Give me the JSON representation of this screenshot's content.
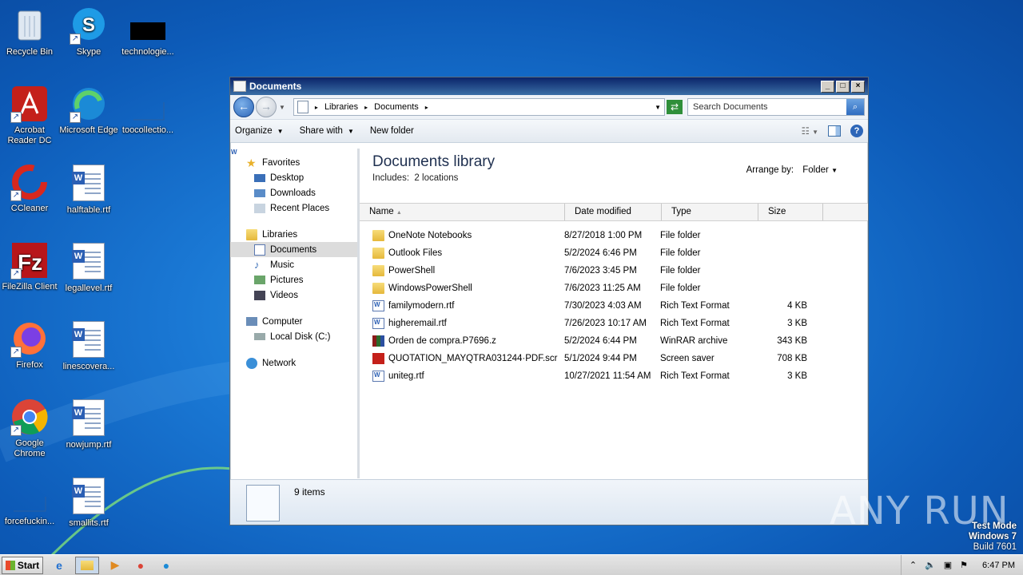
{
  "desktop": {
    "icons": [
      {
        "label": "Recycle Bin"
      },
      {
        "label": "Skype"
      },
      {
        "label": "technologie..."
      },
      {
        "label": "Acrobat Reader DC"
      },
      {
        "label": "Microsoft Edge"
      },
      {
        "label": "toocollectio..."
      },
      {
        "label": "CCleaner"
      },
      {
        "label": "halftable.rtf"
      },
      {
        "label": "FileZilla Client"
      },
      {
        "label": "legallevel.rtf"
      },
      {
        "label": "Firefox"
      },
      {
        "label": "linescovera..."
      },
      {
        "label": "Google Chrome"
      },
      {
        "label": "nowjump.rtf"
      },
      {
        "label": "forcefuckin..."
      },
      {
        "label": "smallits.rtf"
      }
    ]
  },
  "window": {
    "title": "Documents",
    "breadcrumb": [
      "Libraries",
      "Documents"
    ],
    "search_placeholder": "Search Documents",
    "toolbar": {
      "organize": "Organize",
      "share_with": "Share with",
      "new_folder": "New folder"
    },
    "nav": {
      "favorites": "Favorites",
      "desktop": "Desktop",
      "downloads": "Downloads",
      "recent_places": "Recent Places",
      "libraries": "Libraries",
      "documents": "Documents",
      "music": "Music",
      "pictures": "Pictures",
      "videos": "Videos",
      "computer": "Computer",
      "local_disk": "Local Disk (C:)",
      "network": "Network"
    },
    "library": {
      "title": "Documents library",
      "includes_label": "Includes:",
      "includes_link": "2 locations",
      "arrange_label": "Arrange by:",
      "arrange_value": "Folder"
    },
    "columns": {
      "name": "Name",
      "date": "Date modified",
      "type": "Type",
      "size": "Size"
    },
    "files": [
      {
        "name": "OneNote Notebooks",
        "date": "8/27/2018 1:00 PM",
        "type": "File folder",
        "size": "",
        "icon": "folder-icon"
      },
      {
        "name": "Outlook Files",
        "date": "5/2/2024 6:46 PM",
        "type": "File folder",
        "size": "",
        "icon": "folder-icon"
      },
      {
        "name": "PowerShell",
        "date": "7/6/2023 3:45 PM",
        "type": "File folder",
        "size": "",
        "icon": "folder-icon"
      },
      {
        "name": "WindowsPowerShell",
        "date": "7/6/2023 11:25 AM",
        "type": "File folder",
        "size": "",
        "icon": "folder-icon"
      },
      {
        "name": "familymodern.rtf",
        "date": "7/30/2023 4:03 AM",
        "type": "Rich Text Format",
        "size": "4 KB",
        "icon": "rtf-icon"
      },
      {
        "name": "higheremail.rtf",
        "date": "7/26/2023 10:17 AM",
        "type": "Rich Text Format",
        "size": "3 KB",
        "icon": "rtf-icon"
      },
      {
        "name": "Orden de compra.P7696.z",
        "date": "5/2/2024 6:44 PM",
        "type": "WinRAR archive",
        "size": "343 KB",
        "icon": "rar-icon"
      },
      {
        "name": "QUOTATION_MAYQTRA031244·PDF.scr",
        "date": "5/1/2024 9:44 PM",
        "type": "Screen saver",
        "size": "708 KB",
        "icon": "pdf-icon"
      },
      {
        "name": "uniteg.rtf",
        "date": "10/27/2021 11:54 AM",
        "type": "Rich Text Format",
        "size": "3 KB",
        "icon": "rtf-icon"
      }
    ],
    "status": "9 items"
  },
  "taskbar": {
    "start": "Start",
    "clock": "6:47 PM"
  },
  "watermark": {
    "line1": "Test Mode",
    "line2": "Windows 7",
    "line3": "Build 7601",
    "brand": "ANY RUN"
  }
}
